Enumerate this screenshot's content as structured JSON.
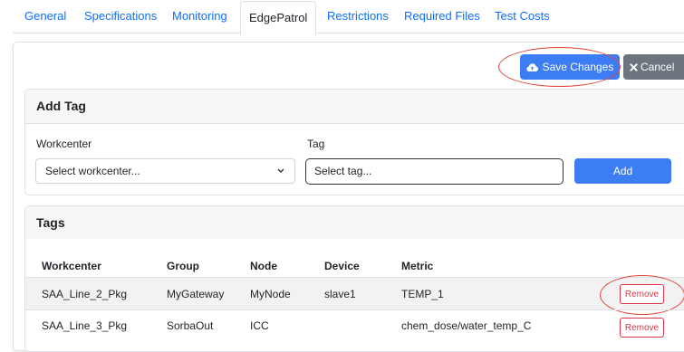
{
  "tabs": [
    {
      "label": "General"
    },
    {
      "label": "Specifications"
    },
    {
      "label": "Monitoring"
    },
    {
      "label": "EdgePatrol"
    },
    {
      "label": "Restrictions"
    },
    {
      "label": "Required Files"
    },
    {
      "label": "Test Costs"
    }
  ],
  "active_tab": "EdgePatrol",
  "toolbar": {
    "save_label": "Save Changes",
    "cancel_label": "Cancel",
    "save_icon": "cloud-upload-icon",
    "cancel_icon": "close-icon"
  },
  "add_tag": {
    "title": "Add Tag",
    "workcenter_label": "Workcenter",
    "workcenter_value": "Select workcenter...",
    "tag_label": "Tag",
    "tag_placeholder": "Select tag...",
    "add_label": "Add"
  },
  "tags": {
    "title": "Tags",
    "columns": [
      "Workcenter",
      "Group",
      "Node",
      "Device",
      "Metric"
    ],
    "rows": [
      {
        "workcenter": "SAA_Line_2_Pkg",
        "group": "MyGateway",
        "node": "MyNode",
        "device": "slave1",
        "metric": "TEMP_1",
        "action": "Remove"
      },
      {
        "workcenter": "SAA_Line_3_Pkg",
        "group": "SorbaOut",
        "node": "ICC",
        "device": "",
        "metric": "chem_dose/water_temp_C",
        "action": "Remove"
      }
    ]
  },
  "colors": {
    "primary": "#3d7df3",
    "secondary": "#6c757d",
    "danger": "#dc3545",
    "highlight_ring": "#e0453a"
  }
}
